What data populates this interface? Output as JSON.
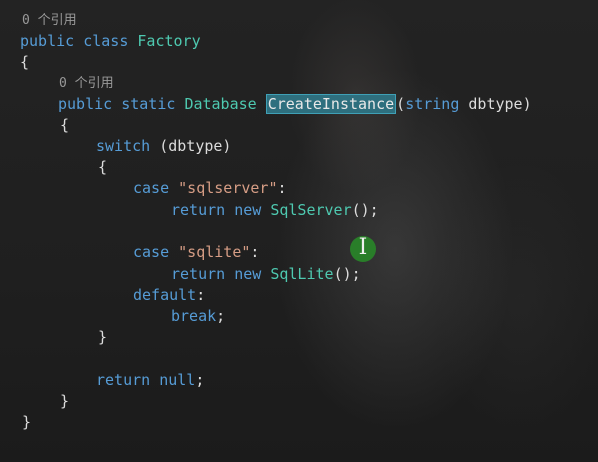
{
  "code": {
    "refs_class": "0 个引用",
    "refs_method": "0 个引用",
    "l_public1": "public",
    "l_class": "class",
    "l_factory": "Factory",
    "l_brace_open_class": "{",
    "l_public2": "public",
    "l_static": "static",
    "l_database": "Database",
    "l_method_name": "CreateInstance",
    "l_paren_open": "(",
    "l_string": "string",
    "l_param": "dbtype",
    "l_paren_close": ")",
    "l_brace_open_method": "{",
    "l_switch": "switch",
    "l_switch_arg": "(dbtype)",
    "l_brace_open_switch": "{",
    "l_case1": "case",
    "l_str_sqlserver": "\"sqlserver\"",
    "l_colon1": ":",
    "l_return1": "return",
    "l_new1": "new",
    "l_sqlserver": "SqlServer",
    "l_call1": "();",
    "l_case2": "case",
    "l_str_sqlite": "\"sqlite\"",
    "l_colon2": ":",
    "l_return2": "return",
    "l_new2": "new",
    "l_sqllite": "SqlLite",
    "l_call2": "();",
    "l_default": "default",
    "l_colon3": ":",
    "l_break": "break",
    "l_semi_break": ";",
    "l_brace_close_switch": "}",
    "l_return3": "return",
    "l_null": "null",
    "l_semi_null": ";",
    "l_brace_close_method": "}",
    "l_brace_close_class": "}"
  },
  "icons": {
    "cursor": "text-cursor-icon"
  },
  "colors": {
    "keyword": "#569cd6",
    "type": "#4ec9b0",
    "string": "#d69d85",
    "selection": "#2e6f7e"
  }
}
